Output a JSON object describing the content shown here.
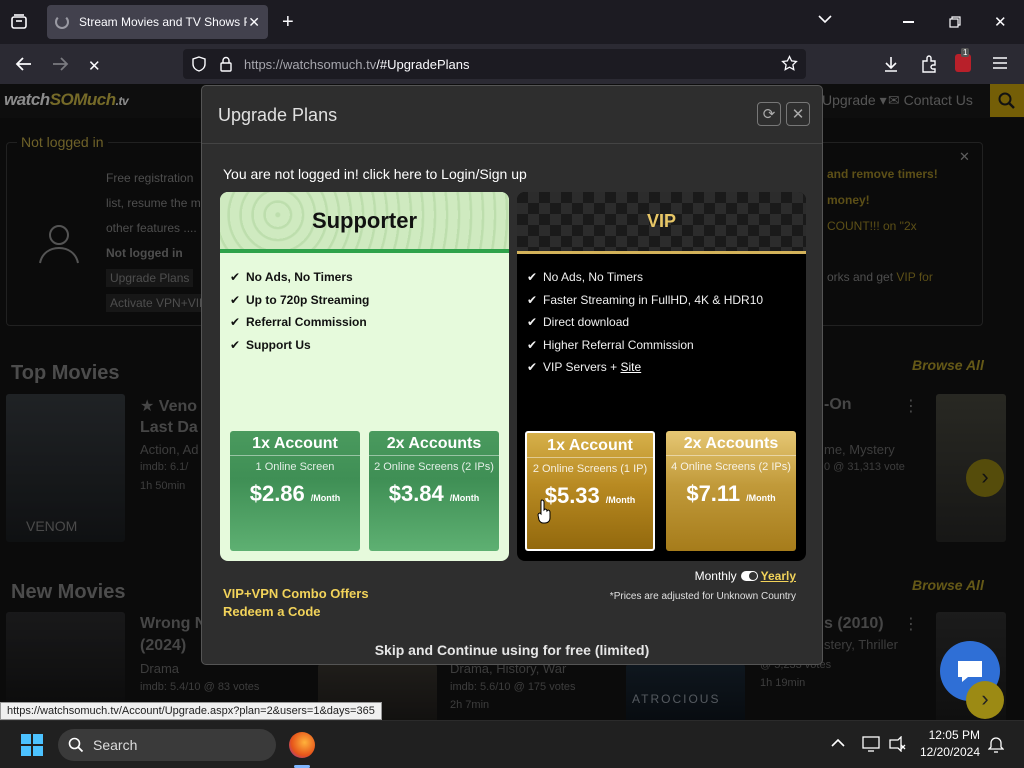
{
  "browser": {
    "tab_title": "Stream Movies and TV Shows F",
    "url_host": "https://watchsomuch.tv",
    "url_path": "/#UpgradePlans",
    "ext_badge": "1"
  },
  "site": {
    "logo_a": "watch",
    "logo_b": "SOMuch",
    "logo_c": ".tv",
    "nav_upgrade": "Upgrade",
    "nav_contact": "Contact Us",
    "login_legend": "Not logged in",
    "login_lines": [
      "Free registration",
      "list, resume the m",
      "other features ...."
    ],
    "login_status": "Not logged in",
    "login_btn1": "Upgrade Plans",
    "login_btn2": "Activate VPN+VIP",
    "promo_1": "and remove timers!",
    "promo_2": "money!",
    "promo_3": "COUNT!!! on \"2x",
    "promo_4": "orks and get",
    "promo_4b": "VIP for",
    "top_movies": "Top Movies",
    "new_movies": "New Movies",
    "browse_all": "Browse All",
    "movies_top": [
      {
        "title_1": "Veno",
        "title_2": "Last Da",
        "genre": "Action, Ad",
        "rating": "imdb: 6.1/",
        "length": "1h 50min"
      },
      {
        "title_1": "-On",
        "genre": "me, Mystery",
        "rating": "0 @ 31,313 vote"
      }
    ],
    "movies_new": [
      {
        "title_1": "Wrong N",
        "title_2": "(2024)",
        "genre": "Drama",
        "rating": "imdb: 5.4/10 @ 83 votes"
      },
      {
        "genre": "Drama, History, War",
        "rating": "imdb: 5.6/10 @ 175 votes",
        "length": "2h 7min"
      },
      {
        "title_1": "s (2010)",
        "genre": "stery, Thriller",
        "rating": "@ 5,233 votes",
        "length": "1h 19min"
      }
    ],
    "poster_text_venom": "VENOM",
    "poster_text_atrocious": "ATROCIOUS"
  },
  "modal": {
    "title": "Upgrade Plans",
    "login_msg": "You are not logged in! click here to Login/Sign up",
    "supporter": {
      "name": "Supporter",
      "features": [
        "No Ads, No Timers",
        "Up to 720p Streaming",
        "Referral Commission",
        "Support Us"
      ],
      "prices": [
        {
          "head": "1x Account",
          "sub": "1 Online Screen",
          "price": "$2.86",
          "per": "/Month"
        },
        {
          "head": "2x Accounts",
          "sub": "2 Online Screens (2 IPs)",
          "price": "$3.84",
          "per": "/Month"
        }
      ]
    },
    "vip": {
      "name": "VIP",
      "features": [
        "No Ads, No Timers",
        "Faster Streaming in FullHD, 4K & HDR10",
        "Direct download",
        "Higher Referral Commission",
        "VIP Servers + "
      ],
      "site_link": "Site",
      "prices": [
        {
          "head": "1x Account",
          "sub": "2 Online Screens (1 IP)",
          "price": "$5.33",
          "per": "/Month"
        },
        {
          "head": "2x Accounts",
          "sub": "4 Online Screens (2 IPs)",
          "price": "$7.11",
          "per": "/Month"
        }
      ]
    },
    "combo": "VIP+VPN Combo Offers",
    "redeem": "Redeem a Code",
    "monthly": "Monthly",
    "yearly": "Yearly",
    "adjusted": "*Prices are adjusted for Unknown Country",
    "skip": "Skip and Continue using for free (limited)"
  },
  "status_url": "https://watchsomuch.tv/Account/Upgrade.aspx?plan=2&users=1&days=365",
  "taskbar": {
    "search": "Search",
    "time": "12:05 PM",
    "date": "12/20/2024"
  }
}
